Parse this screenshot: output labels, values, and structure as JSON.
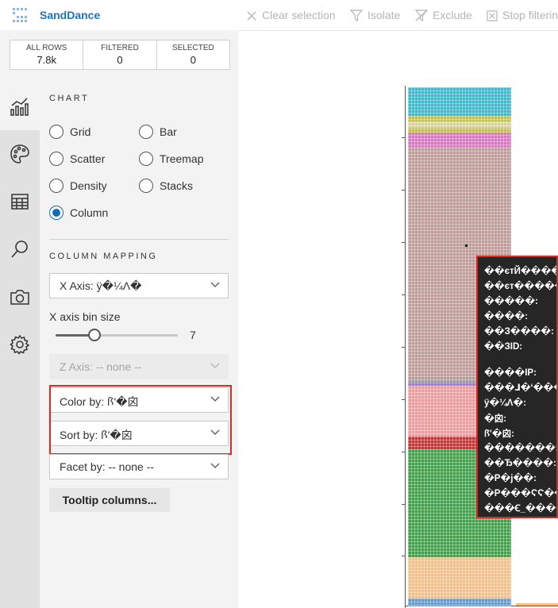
{
  "app": {
    "title": "SandDance",
    "toolbar": {
      "clear_selection": "Clear selection",
      "isolate": "Isolate",
      "exclude": "Exclude",
      "stop_filtering": "Stop filtering"
    }
  },
  "counts": [
    {
      "label": "ALL ROWS",
      "value": "7.8k"
    },
    {
      "label": "FILTERED",
      "value": "0"
    },
    {
      "label": "SELECTED",
      "value": "0"
    }
  ],
  "sidebar_icons": [
    "chart-icon",
    "palette-icon",
    "table-icon",
    "search-icon",
    "camera-icon",
    "settings-icon"
  ],
  "chart_section": {
    "title": "CHART",
    "types": [
      {
        "label": "Grid",
        "selected": false
      },
      {
        "label": "Bar",
        "selected": false
      },
      {
        "label": "Scatter",
        "selected": false
      },
      {
        "label": "Treemap",
        "selected": false
      },
      {
        "label": "Density",
        "selected": false
      },
      {
        "label": "Stacks",
        "selected": false
      },
      {
        "label": "Column",
        "selected": true
      }
    ]
  },
  "column_mapping": {
    "title": "COLUMN MAPPING",
    "x_axis": "X Axis: ÿ�¼Λ�",
    "bin_size_label": "X axis bin size",
    "bin_size_value": "7",
    "bin_size_fraction": 0.3,
    "z_axis": "Z Axis: -- none --",
    "color_by": "Color by: ꟗ'�囟",
    "sort_by": "Sort by: ꟗ'�囟",
    "facet_by": "Facet by: -- none --",
    "tooltip_button": "Tooltip columns..."
  },
  "tooltip_lines": [
    "��єтЙ����:",
    "��єт�����",
    "�����:",
    "����:",
    "��З����:",
    "��ЗID:",
    "",
    "����IP:",
    "���⅃�ʻ����",
    "ÿ�¼Λ�:",
    "�囟:",
    "ꟗ'�囟:",
    "�������:",
    "��Ђ����:",
    "�Р�ϳ��:",
    "�Р���ϚϚ���",
    "���Ꞓ_����"
  ],
  "chart_data": {
    "type": "bar",
    "description_colors": {
      "cyan": "#2dbfd6",
      "olive": "#c8c23a",
      "pink": "#e070c8",
      "rose": "#c49a96",
      "purple": "#9a78d8",
      "salmon": "#f4979a",
      "red": "#d82c2c",
      "green": "#34a83e",
      "peach": "#fbbd7d",
      "blue": "#5a9bd8"
    }
  }
}
